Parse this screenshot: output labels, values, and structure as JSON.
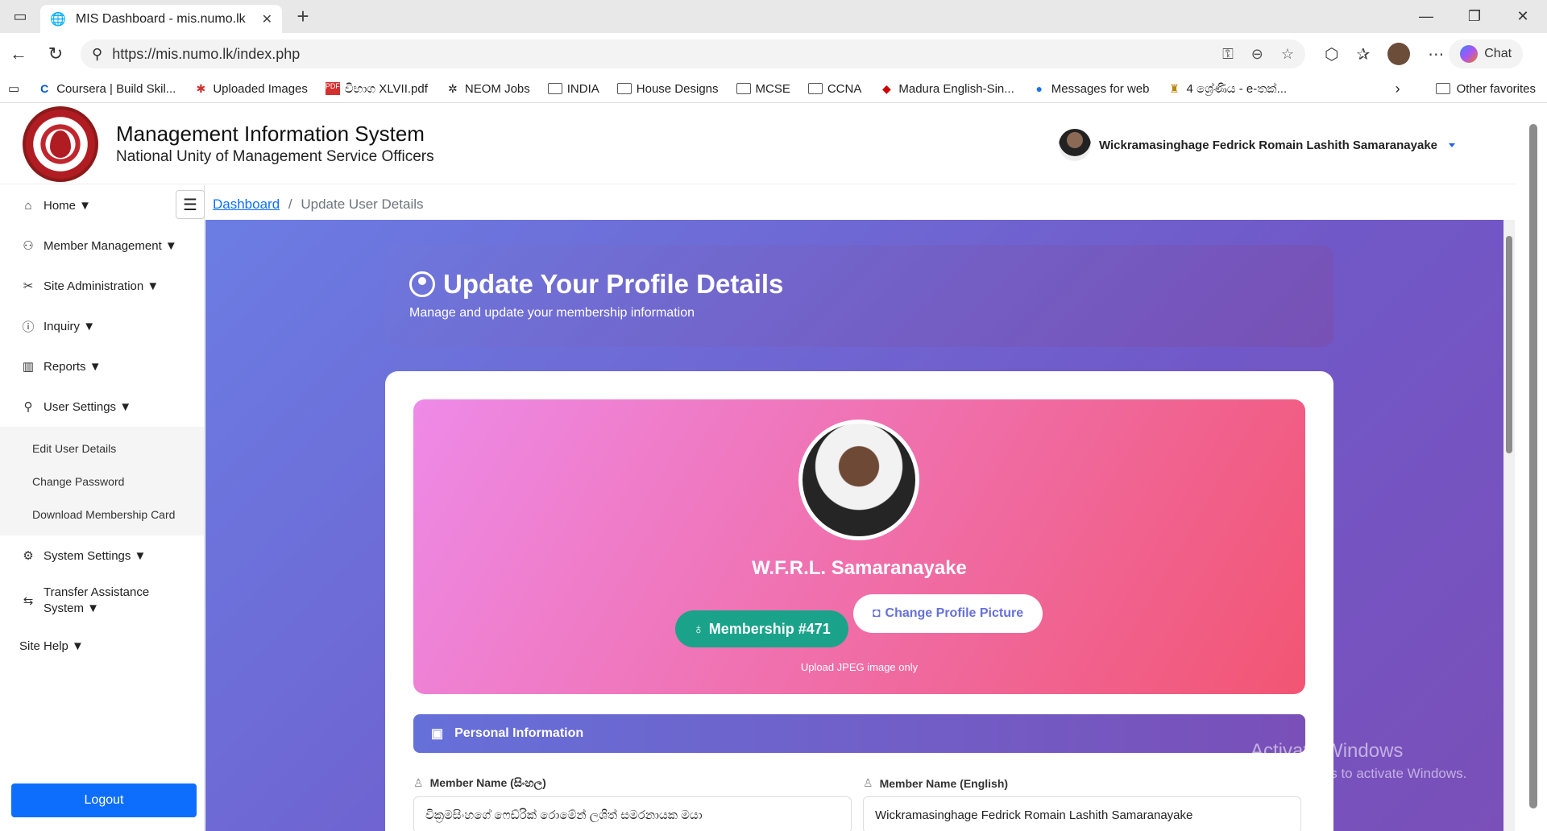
{
  "browser": {
    "tab_title": "MIS Dashboard - mis.numo.lk",
    "url": "https://mis.numo.lk/index.php",
    "chat_label": "Chat",
    "favorites": [
      {
        "label": "Coursera | Build Skil...",
        "icon": "coursera-icon"
      },
      {
        "label": "Uploaded Images",
        "icon": "images-icon"
      },
      {
        "label": "විභාග XLVII.pdf",
        "icon": "pdf-icon"
      },
      {
        "label": "NEOM Jobs",
        "icon": "neom-icon"
      },
      {
        "label": "INDIA",
        "icon": "folder-icon"
      },
      {
        "label": "House Designs",
        "icon": "folder-icon"
      },
      {
        "label": "MCSE",
        "icon": "folder-icon"
      },
      {
        "label": "CCNA",
        "icon": "folder-icon"
      },
      {
        "label": "Madura English-Sin...",
        "icon": "dictionary-icon"
      },
      {
        "label": "Messages for web",
        "icon": "messages-icon"
      },
      {
        "label": "4 ශ්‍රේණිය - e-තක්...",
        "icon": "emblem-icon"
      }
    ],
    "other_favorites": "Other favorites"
  },
  "header": {
    "title": "Management Information System",
    "subtitle": "National Unity of Management Service Officers",
    "user_name": "Wickramasinghage Fedrick Romain Lashith Samaranayake"
  },
  "sidebar": {
    "items": [
      {
        "label": "Home ▼",
        "icon": "home-icon"
      },
      {
        "label": "Member Management ▼",
        "icon": "users-icon"
      },
      {
        "label": "Site Administration ▼",
        "icon": "tools-icon"
      },
      {
        "label": "Inquiry ▼",
        "icon": "question-icon"
      },
      {
        "label": "Reports ▼",
        "icon": "chart-icon"
      },
      {
        "label": "User Settings ▼",
        "icon": "user-gear-icon"
      }
    ],
    "sub_items": [
      "Edit User Details",
      "Change Password",
      "Download Membership Card"
    ],
    "items2": [
      {
        "label": "System Settings ▼",
        "icon": "gear-icon"
      },
      {
        "label": "Transfer Assistance System ▼",
        "icon": "transfer-icon"
      },
      {
        "label": "Site Help ▼",
        "icon": ""
      }
    ],
    "logout_label": "Logout"
  },
  "breadcrumb": {
    "home": "Dashboard",
    "sep": "/",
    "current": "Update User Details"
  },
  "hero": {
    "title": "Update Your Profile Details",
    "subtitle": "Manage and update your membership information"
  },
  "profile": {
    "name": "W.F.R.L. Samaranayake",
    "membership": "Membership #471",
    "change_picture": "Change Profile Picture",
    "upload_hint": "Upload JPEG image only"
  },
  "personal": {
    "section_title": "Personal Information",
    "name_si_label": "Member Name (සිංහල)",
    "name_si_value": "වික්‍රමසිංහගේ ෆෙඩ්රික් රොමේන් ලශිත් සමරනායක මයා",
    "name_en_label": "Member Name (English)",
    "name_en_value": "Wickramasinghage Fedrick Romain Lashith Samaranayake"
  },
  "watermark": {
    "line1": "Activate Windows",
    "line2": "Go to Settings to activate Windows."
  }
}
